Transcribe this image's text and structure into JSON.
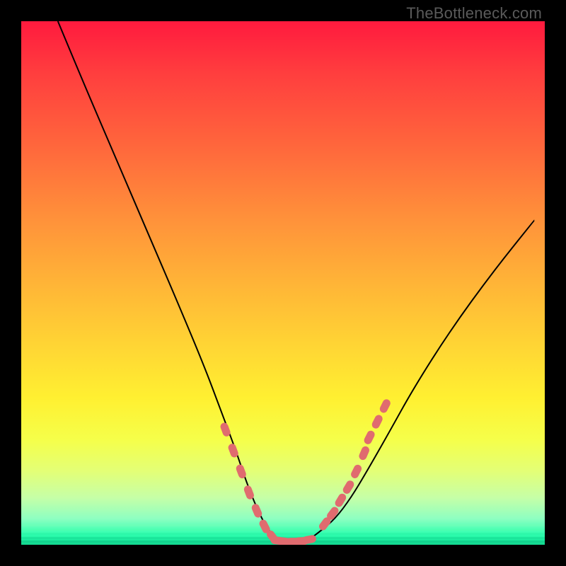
{
  "watermark": "TheBottleneck.com",
  "chart_data": {
    "type": "line",
    "title": "",
    "xlabel": "",
    "ylabel": "",
    "ylim": [
      0,
      100
    ],
    "xlim": [
      0,
      100
    ],
    "series": [
      {
        "name": "bottleneck-curve",
        "x": [
          7,
          12,
          18,
          24,
          30,
          35,
          38,
          41,
          43,
          45,
          47,
          49,
          51,
          53,
          55,
          57,
          60,
          63,
          66,
          70,
          75,
          82,
          90,
          98
        ],
        "y": [
          100,
          88,
          74,
          60,
          46,
          34,
          26,
          18,
          12,
          7,
          3,
          1,
          0.5,
          0.5,
          1,
          2.5,
          5,
          9,
          14,
          21,
          30,
          41,
          52,
          62
        ]
      },
      {
        "name": "marker-band-left",
        "x": [
          39,
          40.5,
          42,
          43.5,
          45,
          46.5,
          48
        ],
        "y": [
          22,
          18,
          14,
          10,
          6.5,
          3.5,
          1.5
        ]
      },
      {
        "name": "marker-band-bottom",
        "x": [
          49,
          50.5,
          52,
          53.5,
          55
        ],
        "y": [
          0.8,
          0.6,
          0.6,
          0.7,
          1.0
        ]
      },
      {
        "name": "marker-band-right",
        "x": [
          58,
          59.5,
          61,
          62.5,
          64,
          65.5
        ],
        "y": [
          4,
          6,
          8.5,
          11,
          14,
          17.5
        ]
      },
      {
        "name": "marker-band-right-upper",
        "x": [
          66.5,
          68,
          69.5
        ],
        "y": [
          20.5,
          23.5,
          26.5
        ]
      }
    ],
    "marker_color": "#e06b6f",
    "curve_color": "#000000"
  }
}
